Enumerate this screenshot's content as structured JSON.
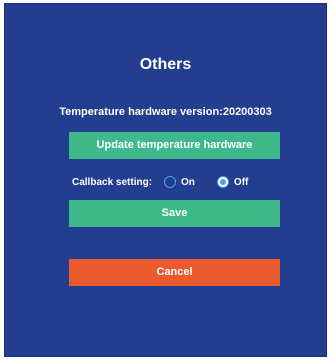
{
  "dialog": {
    "title": "Others",
    "version_text": "Temperature hardware version:20200303",
    "update_button_label": "Update temperature hardware",
    "callback": {
      "label": "Callback setting:",
      "options": [
        {
          "label": "On",
          "selected": false
        },
        {
          "label": "Off",
          "selected": true
        }
      ]
    },
    "save_button_label": "Save",
    "cancel_button_label": "Cancel"
  },
  "colors": {
    "dialog_bg": "#233d8f",
    "primary_button": "#3fb88a",
    "cancel_button": "#eb5a2f",
    "radio_accent": "#4aa0f0",
    "text": "#ffffff"
  }
}
